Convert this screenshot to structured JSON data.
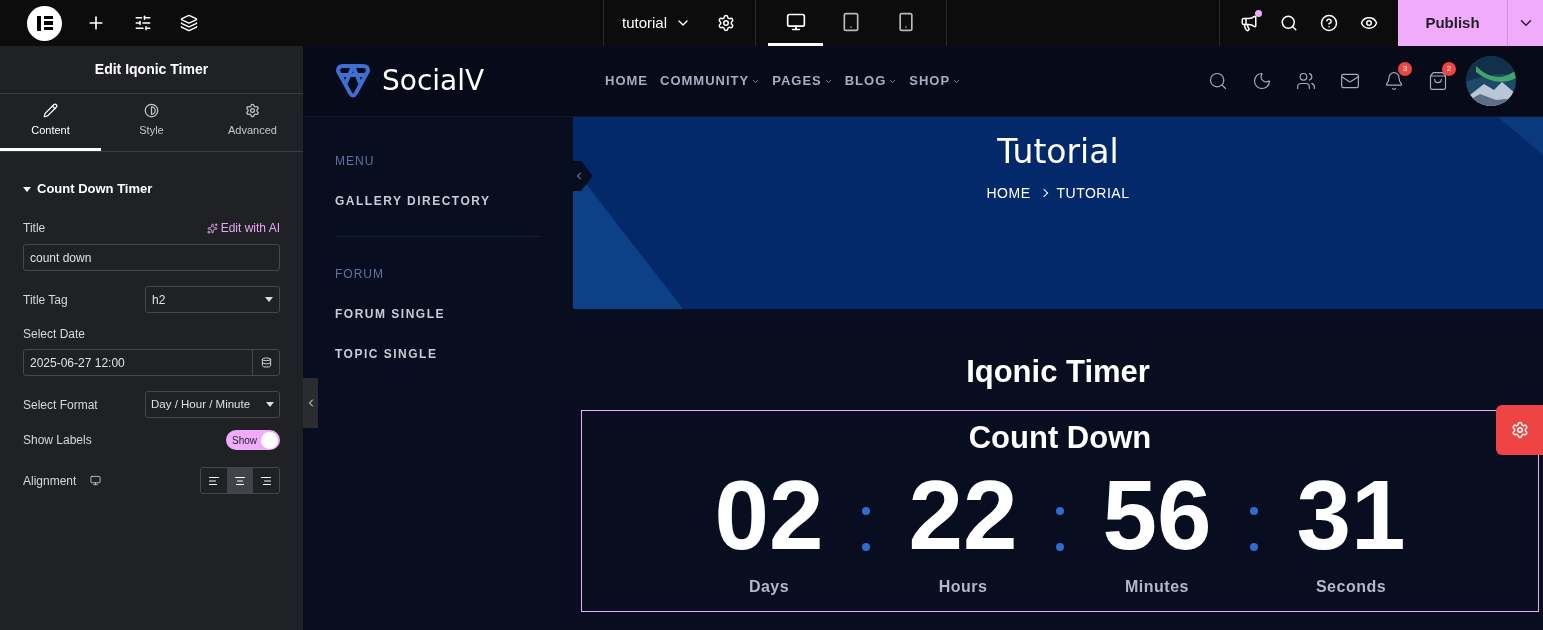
{
  "top_bar": {
    "page_name": "tutorial",
    "devices": [
      {
        "kind": "desktop",
        "selected": true
      },
      {
        "kind": "tablet",
        "selected": false
      },
      {
        "kind": "mobile",
        "selected": false
      }
    ],
    "notification_dot": true,
    "publish": "Publish"
  },
  "panel": {
    "title": "Edit Iqonic Timer",
    "tabs": [
      {
        "kind": "content",
        "label": "Content",
        "selected": true
      },
      {
        "kind": "style",
        "label": "Style",
        "selected": false
      },
      {
        "kind": "advanced",
        "label": "Advanced",
        "selected": false
      }
    ],
    "section": {
      "title": "Count Down Timer",
      "expanded": true
    },
    "title_field": {
      "label": "Title",
      "ai_link": "Edit with AI",
      "value": "count down"
    },
    "title_tag": {
      "label": "Title Tag",
      "value": "h2"
    },
    "select_date": {
      "label": "Select Date",
      "value": "2025-06-27 12:00"
    },
    "select_format": {
      "label": "Select Format",
      "value": "Day / Hour / Minute"
    },
    "show_labels": {
      "label": "Show Labels",
      "toggle_text": "Show",
      "on": true
    },
    "alignment": {
      "label": "Alignment",
      "options": [
        {
          "kind": "left",
          "selected": false
        },
        {
          "kind": "center",
          "selected": true
        },
        {
          "kind": "right",
          "selected": false
        }
      ]
    }
  },
  "site": {
    "logo": "SocialV",
    "nav": [
      {
        "label": "HOME",
        "dropdown": false
      },
      {
        "label": "COMMUNITY",
        "dropdown": true
      },
      {
        "label": "PAGES",
        "dropdown": true
      },
      {
        "label": "BLOG",
        "dropdown": true
      },
      {
        "label": "SHOP",
        "dropdown": true
      }
    ],
    "header_icons": [
      {
        "kind": "search"
      },
      {
        "kind": "moon"
      },
      {
        "kind": "users"
      },
      {
        "kind": "mail"
      },
      {
        "kind": "bell",
        "badge": "3"
      },
      {
        "kind": "bag",
        "badge": "2"
      }
    ],
    "sidebar": [
      {
        "heading": "MENU",
        "items": [
          "GALLERY DIRECTORY"
        ]
      },
      {
        "heading": "FORUM",
        "items": [
          "FORUM SINGLE",
          "TOPIC SINGLE"
        ]
      }
    ],
    "hero": {
      "title": "Tutorial",
      "breadcrumb": [
        "HOME",
        "TUTORIAL"
      ]
    },
    "widget_heading": "Iqonic Timer",
    "timer": {
      "title": "Count Down",
      "units": [
        {
          "value": "02",
          "label": "Days"
        },
        {
          "value": "22",
          "label": "Hours"
        },
        {
          "value": "56",
          "label": "Minutes"
        },
        {
          "value": "31",
          "label": "Seconds"
        }
      ]
    }
  }
}
